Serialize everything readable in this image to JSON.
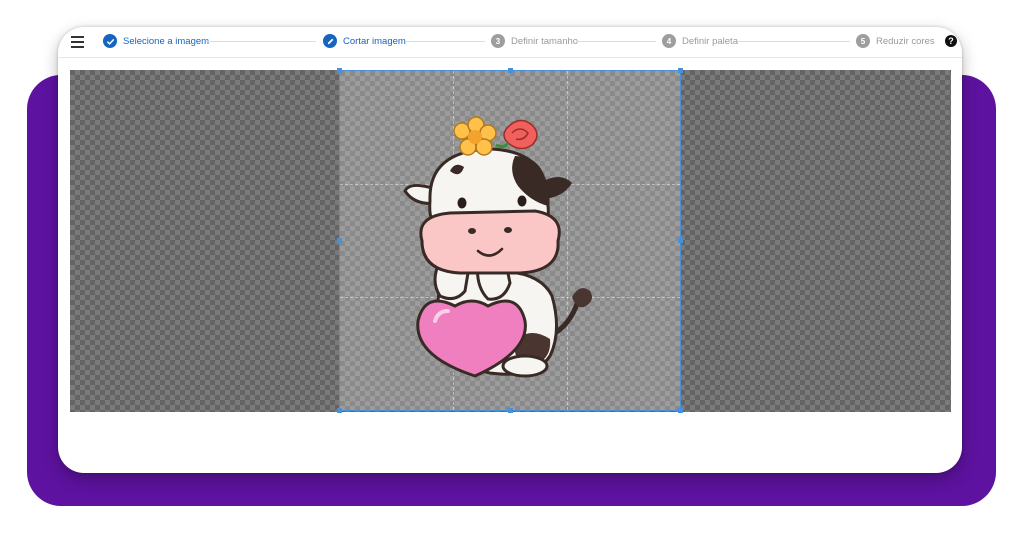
{
  "stepper": {
    "steps": [
      {
        "number": "1",
        "label": "Selecione a imagem",
        "state": "done"
      },
      {
        "number": "2",
        "label": "Cortar imagem",
        "state": "active"
      },
      {
        "number": "3",
        "label": "Definir tamanho",
        "state": "pending"
      },
      {
        "number": "4",
        "label": "Definir paleta",
        "state": "pending"
      },
      {
        "number": "5",
        "label": "Reduzir cores",
        "state": "pending"
      }
    ],
    "help_glyph": "?"
  },
  "icons": {
    "menu": "hamburger-menu-icon",
    "step_done": "checkmark-icon",
    "step_active": "pencil-icon",
    "help": "help-icon"
  },
  "colors": {
    "frame": "#5e12a0",
    "accent": "#1565c0",
    "inactive": "#9e9e9e",
    "crop_border": "#4a90d9"
  }
}
